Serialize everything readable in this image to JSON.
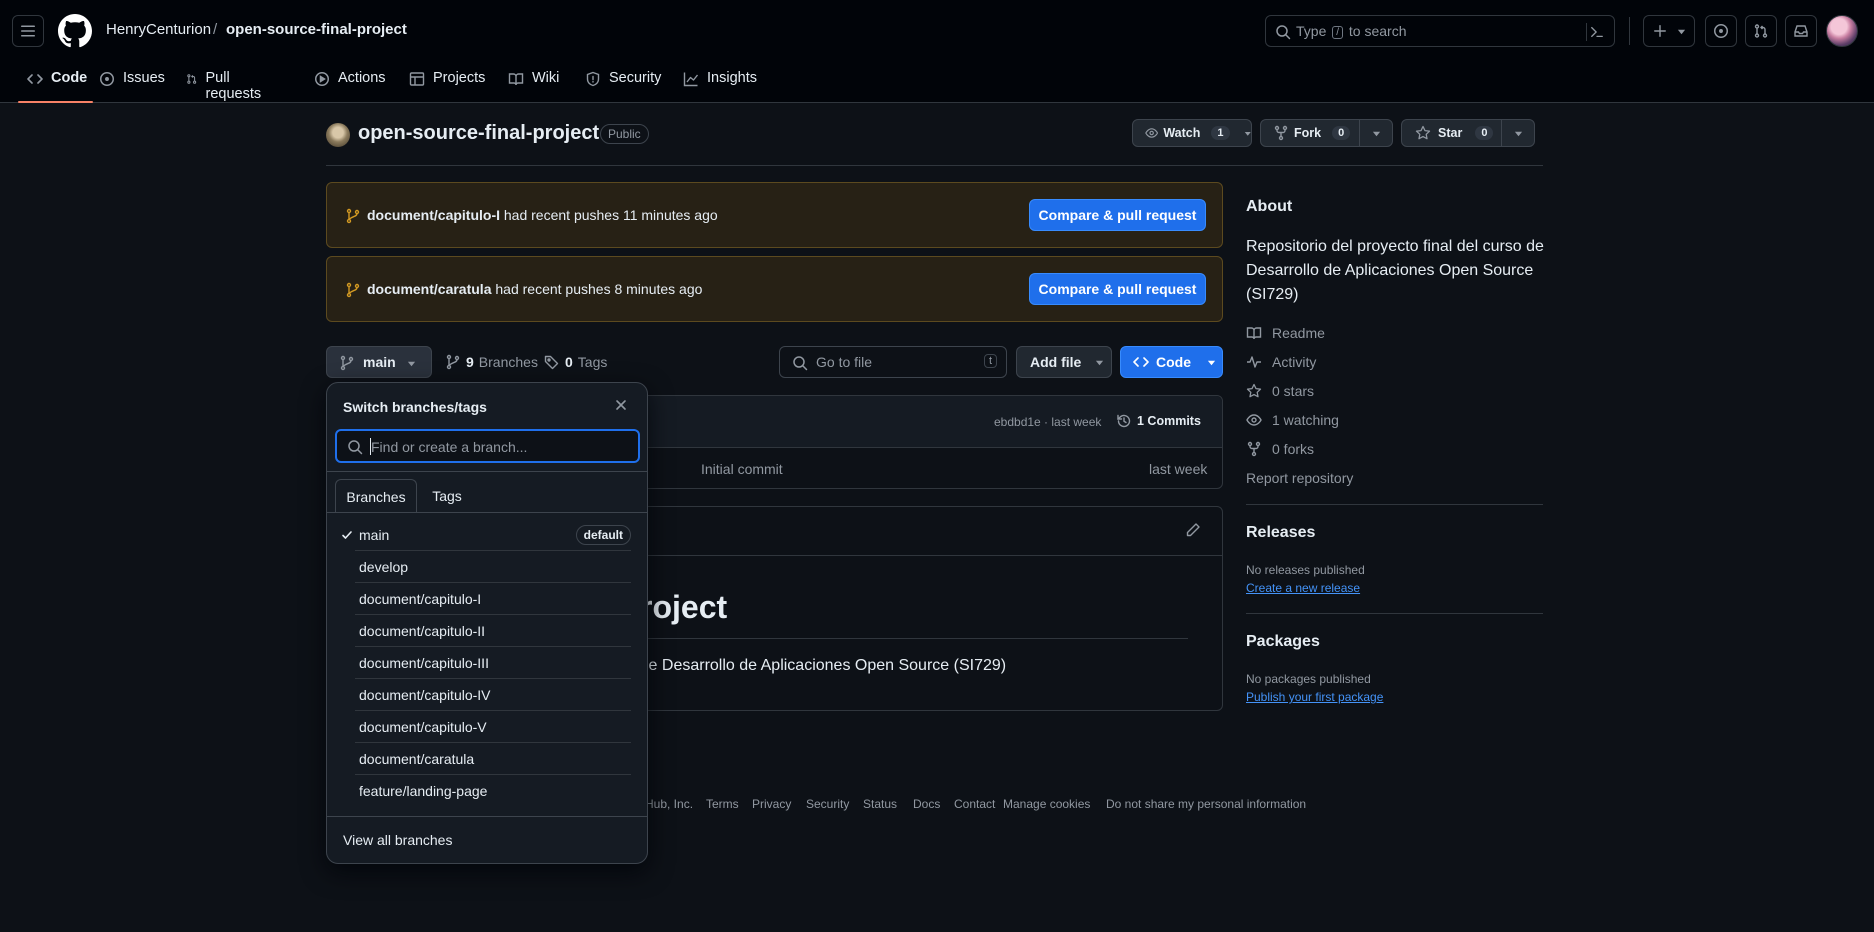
{
  "header": {
    "owner": "HenryCenturion",
    "separator": "/",
    "repo": "open-source-final-project",
    "search_prefix": "Type",
    "search_key": "/",
    "search_suffix": "to search"
  },
  "tabs": [
    {
      "label": "Code",
      "icon": "code-icon"
    },
    {
      "label": "Issues",
      "icon": "issue-icon"
    },
    {
      "label": "Pull requests",
      "icon": "pull-request-icon"
    },
    {
      "label": "Actions",
      "icon": "play-icon"
    },
    {
      "label": "Projects",
      "icon": "table-icon"
    },
    {
      "label": "Wiki",
      "icon": "book-icon"
    },
    {
      "label": "Security",
      "icon": "shield-icon"
    },
    {
      "label": "Insights",
      "icon": "graph-icon"
    }
  ],
  "repo": {
    "name": "open-source-final-project",
    "visibility": "Public",
    "watch_label": "Watch",
    "watch_count": "1",
    "fork_label": "Fork",
    "fork_count": "0",
    "star_label": "Star",
    "star_count": "0"
  },
  "banners": [
    {
      "branch": "document/capitulo-I",
      "text": "had recent pushes 11 minutes ago",
      "button": "Compare & pull request"
    },
    {
      "branch": "document/caratula",
      "text": "had recent pushes 8 minutes ago",
      "button": "Compare & pull request"
    }
  ],
  "file_nav": {
    "branch": "main",
    "branches_count": "9",
    "branches_label": "Branches",
    "tags_count": "0",
    "tags_label": "Tags",
    "goto_placeholder": "Go to file",
    "goto_key": "t",
    "add_file": "Add file",
    "code": "Code"
  },
  "commit": {
    "sha_time": "ebdbd1e · last week",
    "commits": "1 Commits",
    "file_message": "Initial commit",
    "file_time": "last week"
  },
  "readme": {
    "heading_partial": "roject",
    "text_partial": "le Desarrollo de Aplicaciones Open Source (SI729)"
  },
  "about": {
    "title": "About",
    "description": "Repositorio del proyecto final del curso de Desarrollo de Aplicaciones Open Source (SI729)",
    "links": [
      {
        "label": "Readme",
        "icon": "book-icon"
      },
      {
        "label": "Activity",
        "icon": "pulse-icon"
      },
      {
        "label": "0 stars",
        "icon": "star-icon"
      },
      {
        "label": "1 watching",
        "icon": "eye-icon"
      },
      {
        "label": "0 forks",
        "icon": "fork-icon"
      }
    ],
    "report": "Report repository"
  },
  "releases": {
    "title": "Releases",
    "empty": "No releases published",
    "link": "Create a new release"
  },
  "packages": {
    "title": "Packages",
    "empty": "No packages published",
    "link": "Publish your first package"
  },
  "footer": {
    "copyright_partial": "Hub, Inc.",
    "links": [
      "Terms",
      "Privacy",
      "Security",
      "Status",
      "Docs",
      "Contact",
      "Manage cookies",
      "Do not share my personal information"
    ]
  },
  "dropdown": {
    "title": "Switch branches/tags",
    "placeholder": "Find or create a branch...",
    "tab_branches": "Branches",
    "tab_tags": "Tags",
    "default_badge": "default",
    "branches": [
      "main",
      "develop",
      "document/capitulo-I",
      "document/capitulo-II",
      "document/capitulo-III",
      "document/capitulo-IV",
      "document/capitulo-V",
      "document/caratula",
      "feature/landing-page"
    ],
    "view_all": "View all branches"
  }
}
